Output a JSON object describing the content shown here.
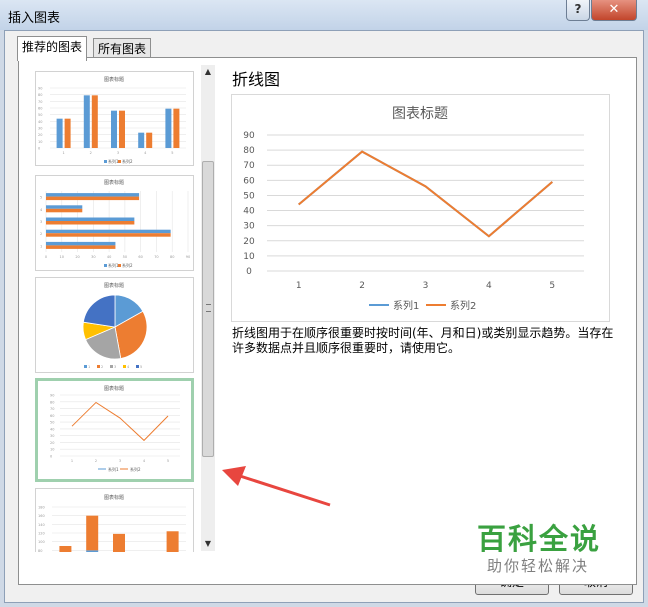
{
  "window": {
    "title": "插入图表",
    "help": "?",
    "close": "✕"
  },
  "tabs": [
    "推荐的图表",
    "所有图表"
  ],
  "main_chart": {
    "type_name": "折线图",
    "description": "折线图用于在顺序很重要时按时间(年、月和日)或类别显示趋势。当存在许多数据点并且顺序很重要时，请使用它。"
  },
  "chart_data": [
    {
      "type": "line",
      "title": "图表标题",
      "x": [
        1,
        2,
        3,
        4,
        5
      ],
      "series": [
        {
          "name": "系列1",
          "values": [
            44,
            79,
            56,
            23,
            59
          ]
        },
        {
          "name": "系列2",
          "values": [
            44,
            79,
            56,
            23,
            59
          ]
        }
      ],
      "ylim": [
        0,
        90
      ],
      "yticks": [
        0,
        10,
        20,
        30,
        40,
        50,
        60,
        70,
        80,
        90
      ],
      "grid": true,
      "legend": "bottom",
      "colors": [
        "#5b9bd5",
        "#ed7d31"
      ]
    }
  ],
  "thumbnails": [
    {
      "type": "clustered-column",
      "title": "图表标题",
      "legend": [
        "系列1",
        "系列2"
      ]
    },
    {
      "type": "clustered-bar",
      "title": "图表标题",
      "legend": [
        "系列1",
        "系列2"
      ]
    },
    {
      "type": "pie",
      "title": "图表标题"
    },
    {
      "type": "line",
      "title": "图表标题",
      "legend": [
        "系列1",
        "系列2"
      ],
      "selected": true
    },
    {
      "type": "stacked-column",
      "title": "图表标题"
    }
  ],
  "buttons": {
    "ok": "确定",
    "cancel": "取消"
  },
  "watermark": {
    "big": "百科全说",
    "small": "助你轻松解决"
  },
  "colors": {
    "blue": "#5b9bd5",
    "orange": "#ed7d31",
    "gray": "#a5a5a5",
    "yellow": "#ffc000",
    "selected_border": "#9fd0ae",
    "arrow": "#e8463f"
  }
}
